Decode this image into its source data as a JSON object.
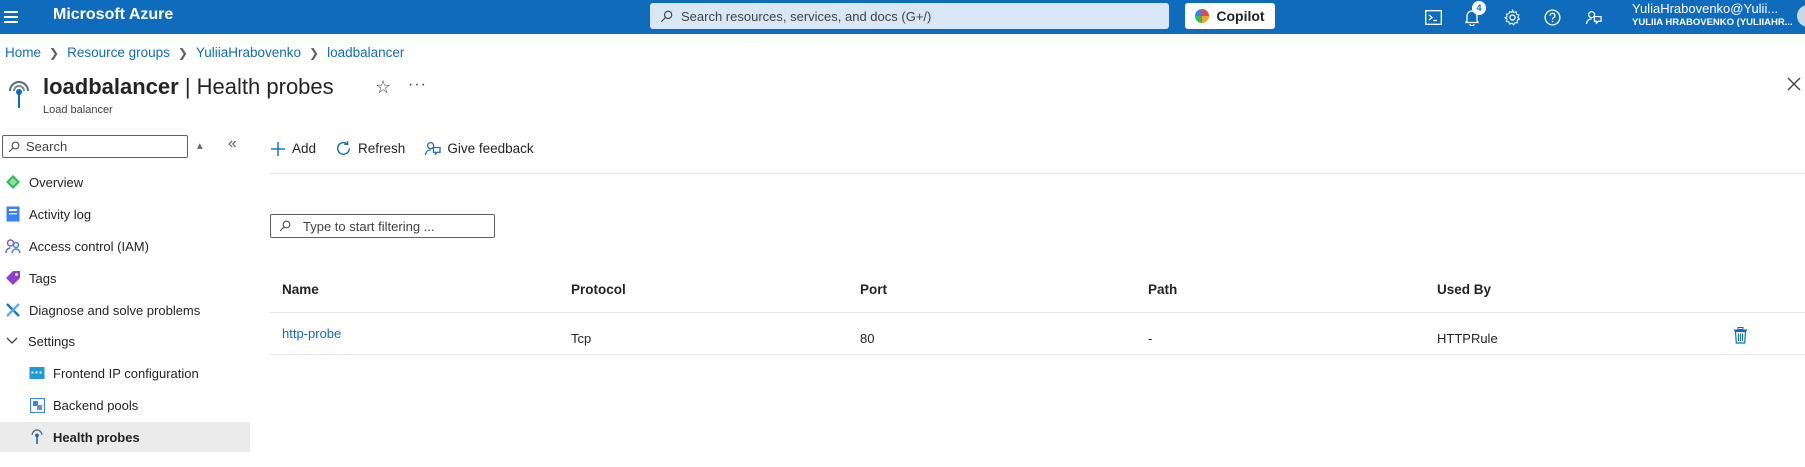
{
  "topbar": {
    "brand": "Microsoft Azure",
    "search_placeholder": "Search resources, services, and docs (G+/)",
    "copilot_label": "Copilot",
    "notification_count": "4",
    "account_name": "YuliaHrabovenko@Yulii...",
    "account_directory": "YULIIA HRABOVENKO (YULIIAHR..."
  },
  "breadcrumb": [
    "Home",
    "Resource groups",
    "YuliiaHrabovenko",
    "loadbalancer"
  ],
  "header": {
    "resource_name": "loadbalancer",
    "separator": " | ",
    "page_title": "Health probes",
    "resource_type": "Load balancer",
    "more_label": "···"
  },
  "sidebar": {
    "search_placeholder": "Search",
    "items": [
      {
        "label": "Overview",
        "icon": "overview-icon"
      },
      {
        "label": "Activity log",
        "icon": "activity-log-icon"
      },
      {
        "label": "Access control (IAM)",
        "icon": "iam-icon"
      },
      {
        "label": "Tags",
        "icon": "tag-icon"
      },
      {
        "label": "Diagnose and solve problems",
        "icon": "diagnose-icon"
      },
      {
        "label": "Settings",
        "icon": "chevron-down-icon"
      },
      {
        "label": "Frontend IP configuration",
        "icon": "frontend-ip-icon"
      },
      {
        "label": "Backend pools",
        "icon": "backend-pools-icon"
      },
      {
        "label": "Health probes",
        "icon": "health-probe-icon",
        "active": true
      }
    ]
  },
  "toolbar": {
    "add_label": "Add",
    "refresh_label": "Refresh",
    "feedback_label": "Give feedback"
  },
  "filter": {
    "placeholder": "Type to start filtering ..."
  },
  "table": {
    "columns": [
      "Name",
      "Protocol",
      "Port",
      "Path",
      "Used By"
    ],
    "rows": [
      {
        "name": "http-probe",
        "protocol": "Tcp",
        "port": "80",
        "path": "-",
        "used_by": "HTTPRule"
      }
    ]
  },
  "colors": {
    "brand_blue": "#0f6cbd",
    "link_blue": "#0f6cbd",
    "active_item_bg": "#ebebeb"
  }
}
